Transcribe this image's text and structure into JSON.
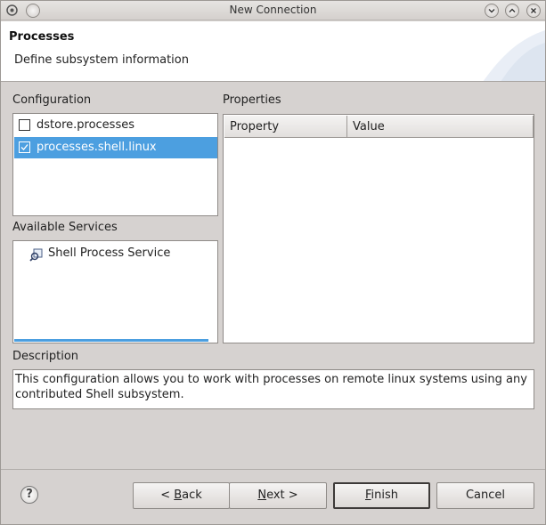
{
  "window": {
    "title": "New Connection"
  },
  "header": {
    "title": "Processes",
    "subtitle": "Define subsystem information"
  },
  "configuration": {
    "label": "Configuration",
    "items": [
      {
        "label": "dstore.processes",
        "checked": false,
        "selected": false
      },
      {
        "label": "processes.shell.linux",
        "checked": true,
        "selected": true
      }
    ]
  },
  "services": {
    "label": "Available Services",
    "items": [
      {
        "label": "Shell Process Service",
        "icon": "service-icon"
      }
    ]
  },
  "properties": {
    "label": "Properties",
    "columns": [
      "Property",
      "Value"
    ]
  },
  "description": {
    "label": "Description",
    "text": "This configuration allows you to work with processes on remote linux systems using any contributed Shell subsystem."
  },
  "buttons": {
    "help": "?",
    "back": {
      "pre": "< ",
      "mn": "B",
      "post": "ack"
    },
    "next": {
      "pre": "",
      "mn": "N",
      "post": "ext >"
    },
    "finish": {
      "pre": "",
      "mn": "F",
      "post": "inish"
    },
    "cancel": "Cancel"
  },
  "colors": {
    "selection": "#4c9fe0",
    "dialog_bg": "#d6d2d0"
  }
}
